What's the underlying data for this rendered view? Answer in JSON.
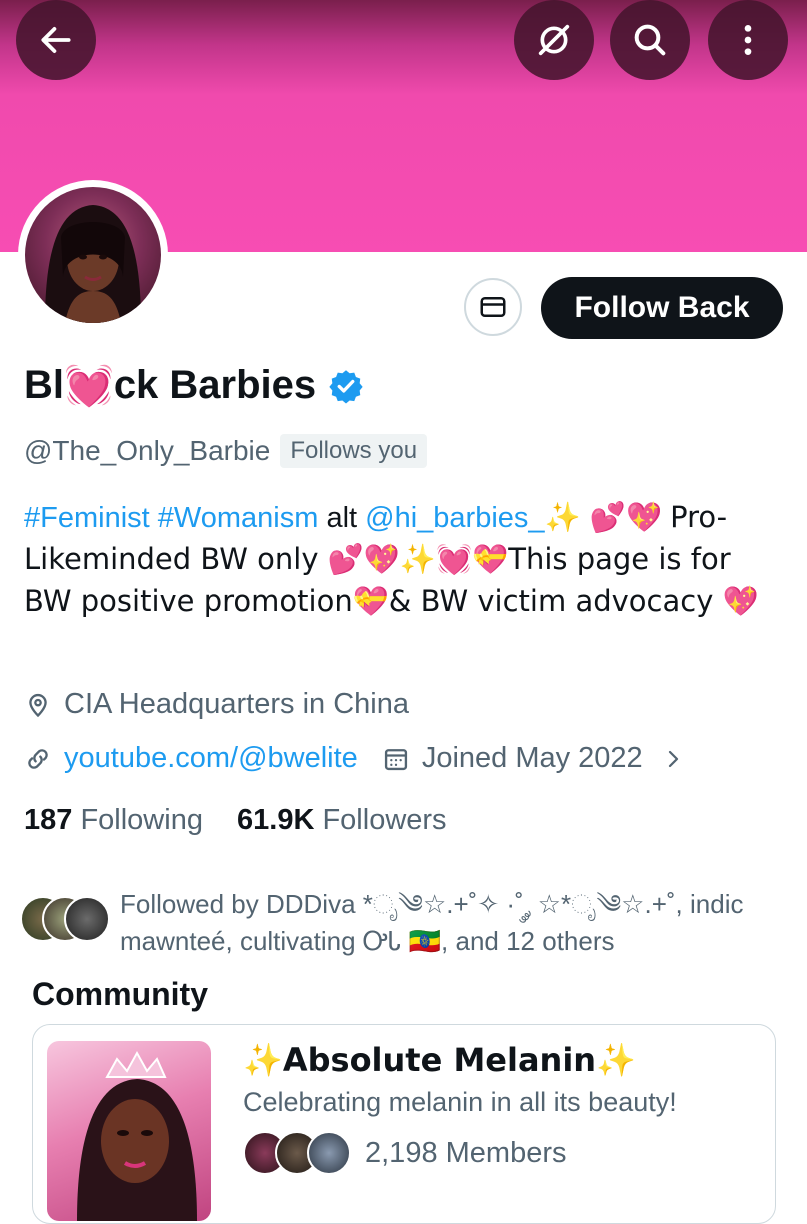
{
  "header": {
    "back_icon": "arrow-left-icon",
    "grok_icon": "slashed-circle-icon",
    "search_icon": "search-icon",
    "more_icon": "vertical-dots-icon",
    "banner_color": "#f74db3"
  },
  "profile": {
    "display_name_prefix": "Bl",
    "display_name_emoji": "💓",
    "display_name_suffix": "ck Barbies",
    "handle": "@The_Only_Barbie",
    "follows_you_badge": "Follows you",
    "follow_button_label": "Follow Back",
    "verified_color": "#1d9bf0"
  },
  "bio": {
    "tag1": "#Feminist",
    "tag2": "#Womanism",
    "alt_text": " alt ",
    "mention": "@hi_barbies_✨",
    "line1_emoji": " 💕💖",
    "text2": "Pro-Likeminded BW only 💕💖✨💓💝This page is for BW positive promotion💝& BW victim advocacy 💖"
  },
  "meta": {
    "location": "CIA Headquarters in China",
    "website": "youtube.com/@bwelite",
    "joined": "Joined May 2022"
  },
  "counts": {
    "following_count": "187",
    "following_label": "Following",
    "followers_count": "61.9K",
    "followers_label": "Followers"
  },
  "followed_by": {
    "text": "Followed by DDDiva *ೃ༄☆.+˚✧ ·˚ ༘ ☆*ೃ༄☆.+˚, indic mawnteé, cultivating ᎤᏓ 🇪🇹, and 12 others"
  },
  "community": {
    "section_title": "Community",
    "name": "✨Absolute Melanin✨",
    "description": "Celebrating melanin in all its beauty!",
    "members": "2,198 Members"
  }
}
